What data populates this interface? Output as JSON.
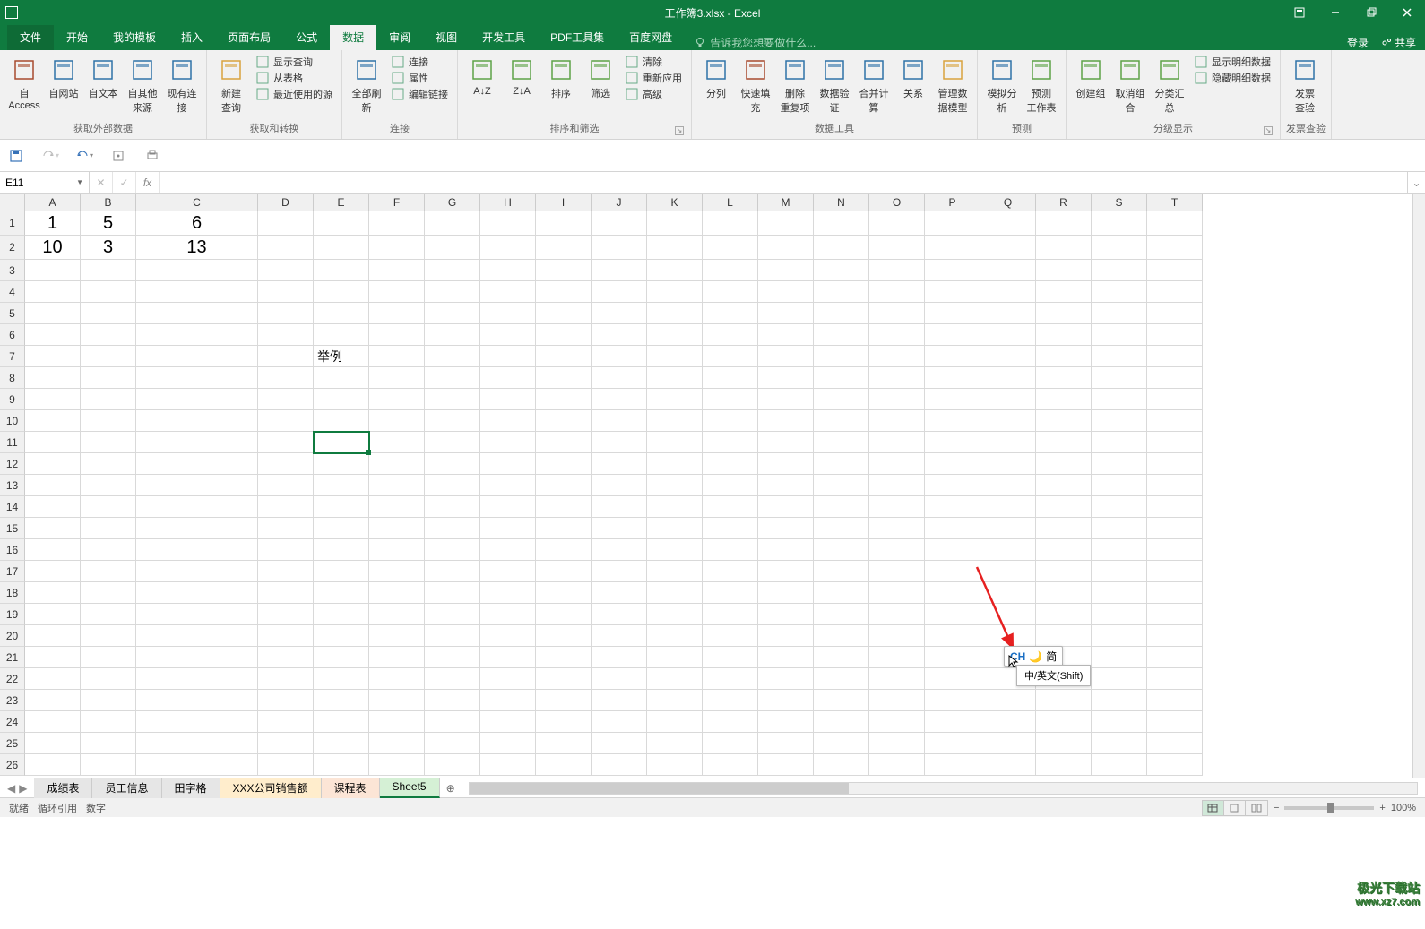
{
  "title": {
    "doc": "工作簿3.xlsx",
    "app": "Excel"
  },
  "titleControls": {
    "ribbonOptions": "功能区选项",
    "minimize": "最小化",
    "restore": "还原",
    "close": "关闭"
  },
  "menu": {
    "file": "文件",
    "tabs": [
      "开始",
      "我的模板",
      "插入",
      "页面布局",
      "公式",
      "数据",
      "审阅",
      "视图",
      "开发工具",
      "PDF工具集",
      "百度网盘"
    ],
    "activeIndex": 5,
    "tellMe": "告诉我您想要做什么...",
    "tellMeIcon": "lightbulb-icon",
    "login": "登录",
    "share": "共享"
  },
  "ribbon": {
    "groups": [
      {
        "label": "获取外部数据",
        "buttons": [
          {
            "name": "from-access",
            "label": "自 Access"
          },
          {
            "name": "from-web",
            "label": "自网站"
          },
          {
            "name": "from-text",
            "label": "自文本"
          },
          {
            "name": "from-other",
            "label": "自其他来源"
          },
          {
            "name": "existing-conn",
            "label": "现有连接"
          }
        ]
      },
      {
        "label": "获取和转换",
        "buttons": [
          {
            "name": "new-query",
            "label": "新建\n查询"
          }
        ],
        "small": [
          {
            "name": "show-queries",
            "label": "显示查询"
          },
          {
            "name": "from-table",
            "label": "从表格"
          },
          {
            "name": "recent-sources",
            "label": "最近使用的源"
          }
        ]
      },
      {
        "label": "连接",
        "buttons": [
          {
            "name": "refresh-all",
            "label": "全部刷新"
          }
        ],
        "small": [
          {
            "name": "connections",
            "label": "连接"
          },
          {
            "name": "properties",
            "label": "属性"
          },
          {
            "name": "edit-links",
            "label": "编辑链接"
          }
        ]
      },
      {
        "label": "排序和筛选",
        "buttons": [
          {
            "name": "sort-asc",
            "label": "A↓Z"
          },
          {
            "name": "sort-desc",
            "label": "Z↓A"
          },
          {
            "name": "sort",
            "label": "排序"
          },
          {
            "name": "filter",
            "label": "筛选"
          }
        ],
        "small": [
          {
            "name": "clear",
            "label": "清除"
          },
          {
            "name": "reapply",
            "label": "重新应用"
          },
          {
            "name": "advanced",
            "label": "高级"
          }
        ]
      },
      {
        "label": "数据工具",
        "buttons": [
          {
            "name": "text-to-cols",
            "label": "分列"
          },
          {
            "name": "flash-fill",
            "label": "快速填充"
          },
          {
            "name": "remove-dup",
            "label": "删除\n重复项"
          },
          {
            "name": "data-val",
            "label": "数据验\n证"
          },
          {
            "name": "consolidate",
            "label": "合并计算"
          },
          {
            "name": "relationships",
            "label": "关系"
          },
          {
            "name": "manage-model",
            "label": "管理数\n据模型"
          }
        ]
      },
      {
        "label": "预测",
        "buttons": [
          {
            "name": "what-if",
            "label": "模拟分析"
          },
          {
            "name": "forecast",
            "label": "预测\n工作表"
          }
        ]
      },
      {
        "label": "分级显示",
        "buttons": [
          {
            "name": "group",
            "label": "创建组"
          },
          {
            "name": "ungroup",
            "label": "取消组合"
          },
          {
            "name": "subtotal",
            "label": "分类汇总"
          }
        ],
        "small": [
          {
            "name": "show-detail",
            "label": "显示明细数据"
          },
          {
            "name": "hide-detail",
            "label": "隐藏明细数据"
          }
        ]
      },
      {
        "label": "发票查验",
        "buttons": [
          {
            "name": "invoice-check",
            "label": "发票\n查验"
          }
        ]
      }
    ]
  },
  "quick": {
    "save": "保存",
    "redo": "重做",
    "undo": "撤消",
    "touch": "触摸模式",
    "print": "打印预览"
  },
  "formulaBar": {
    "nameBox": "E11",
    "cancel": "✕",
    "enter": "✓",
    "fx": "fx",
    "formula": ""
  },
  "grid": {
    "columns": [
      "A",
      "B",
      "C",
      "D",
      "E",
      "F",
      "G",
      "H",
      "I",
      "J",
      "K",
      "L",
      "M",
      "N",
      "O",
      "P",
      "Q",
      "R",
      "S",
      "T"
    ],
    "colWidths": {
      "default": 62,
      "A": 62,
      "B": 62,
      "C": 136
    },
    "rowCount": 26,
    "rowHeightBig": 27,
    "rowHeightDefault": 24,
    "selected": {
      "row": 11,
      "col": "E"
    },
    "data": {
      "1": {
        "A": "1",
        "B": "5",
        "C": "6"
      },
      "2": {
        "A": "10",
        "B": "3",
        "C": "13"
      },
      "7": {
        "E": "举例"
      }
    }
  },
  "sheetBar": {
    "nav": [
      "◀",
      "▶"
    ],
    "tabs": [
      {
        "name": "成绩表",
        "cls": ""
      },
      {
        "name": "员工信息",
        "cls": ""
      },
      {
        "name": "田字格",
        "cls": ""
      },
      {
        "name": "XXX公司销售额",
        "cls": "hl1"
      },
      {
        "name": "课程表",
        "cls": "hl2"
      },
      {
        "name": "Sheet5",
        "cls": "hl3 active"
      }
    ],
    "add": "⊕"
  },
  "statusBar": {
    "left": [
      "就绪",
      "循环引用",
      "数字"
    ],
    "zoom": "100%"
  },
  "ime": {
    "mode": "CH",
    "punct": "ⓘ",
    "simp": "简",
    "tooltip": "中/英文(Shift)"
  },
  "watermark": {
    "cn": "极光下载站",
    "url": "www.xz7.com"
  }
}
